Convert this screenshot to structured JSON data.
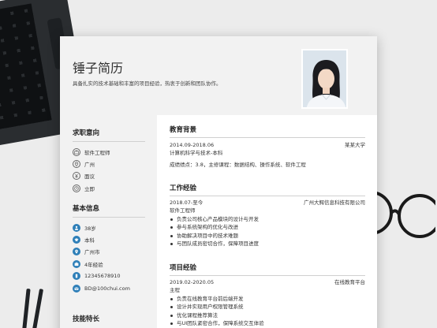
{
  "header": {
    "name": "锤子简历",
    "intro": "具备扎实的技术基础和丰富的项目经验，热衷于创新和团队协作。"
  },
  "sidebar": {
    "intent": {
      "title": "求职意向",
      "items": [
        {
          "label": "软件工程师",
          "icon": "briefcase-icon"
        },
        {
          "label": "广州",
          "icon": "location-icon"
        },
        {
          "label": "面议",
          "icon": "salary-icon"
        },
        {
          "label": "立即",
          "icon": "clock-icon"
        }
      ]
    },
    "basic": {
      "title": "基本信息",
      "items": [
        {
          "label": "38岁",
          "icon": "person-icon"
        },
        {
          "label": "本科",
          "icon": "graduation-cap-icon"
        },
        {
          "label": "广州市",
          "icon": "location-icon"
        },
        {
          "label": "4年经验",
          "icon": "briefcase-icon"
        },
        {
          "label": "12345678910",
          "icon": "phone-icon"
        },
        {
          "label": "BD@100chui.com",
          "icon": "mail-icon"
        }
      ]
    },
    "skills": {
      "title": "技能特长"
    }
  },
  "main": {
    "education": {
      "title": "教育背景",
      "date": "2014.09-2018.06",
      "school": "某某大学",
      "major": "计算机科学与技术-本科",
      "detail": "成绩绩点：3.8，主修课程：数据结构、操作系统、软件工程"
    },
    "work": {
      "title": "工作经验",
      "date": "2018.07-至今",
      "company": "广州大鳄信息科技有限公司",
      "position": "软件工程师",
      "bullets": [
        "负责公司核心产品模块的设计与开发",
        "参与系统架构的优化与改进",
        "协助解决项目中的技术难题",
        "与团队成员密切合作，保障项目进度"
      ]
    },
    "project": {
      "title": "项目经验",
      "date": "2019.02-2020.05",
      "org": "在线教育平台",
      "role": "主程",
      "bullets": [
        "负责在线教育平台前后端开发",
        "设计并实现用户权限管理系统",
        "优化课程推荐算法",
        "与UI团队紧密合作，保障系统交互体验"
      ]
    }
  },
  "colors": {
    "accent": "#2e7fb8",
    "header_bg": "#f2f2f2",
    "desk_bg": "#ececec"
  }
}
